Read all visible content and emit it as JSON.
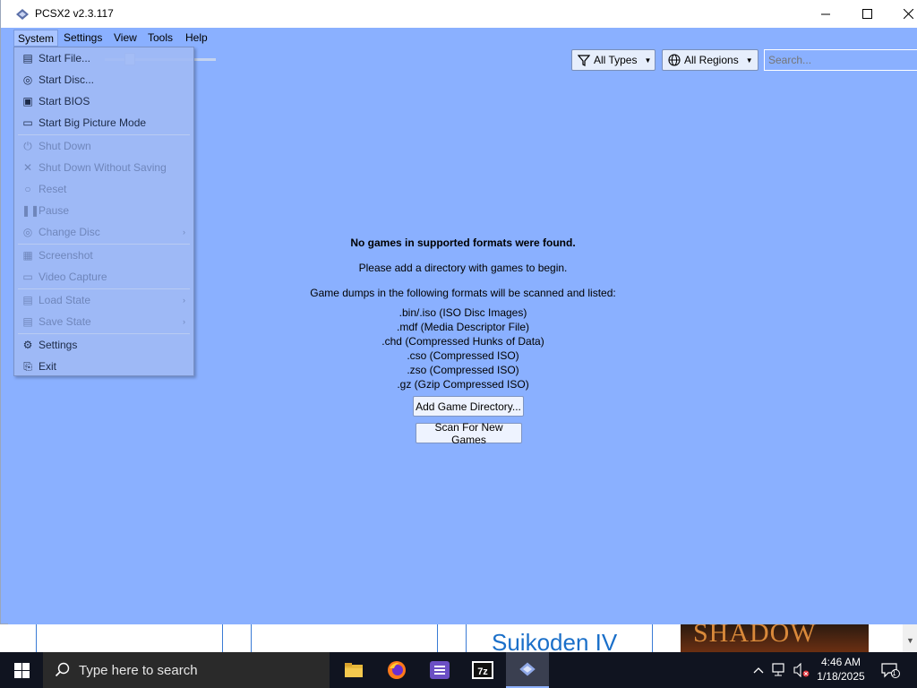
{
  "window": {
    "title": "PCSX2 v2.3.117"
  },
  "menubar": {
    "items": [
      {
        "label": "System"
      },
      {
        "label": "Settings"
      },
      {
        "label": "View"
      },
      {
        "label": "Tools"
      },
      {
        "label": "Help"
      }
    ]
  },
  "toolbar": {
    "type_filter": "All Types",
    "region_filter": "All Regions",
    "search_placeholder": "Search..."
  },
  "system_menu": {
    "items": [
      {
        "label": "Start File...",
        "icon": "file-icon",
        "enabled": true
      },
      {
        "label": "Start Disc...",
        "icon": "disc-icon",
        "enabled": true
      },
      {
        "label": "Start BIOS",
        "icon": "chip-icon",
        "enabled": true
      },
      {
        "label": "Start Big Picture Mode",
        "icon": "big-picture-icon",
        "enabled": true
      },
      {
        "label": "Shut Down",
        "icon": "power-icon",
        "enabled": false
      },
      {
        "label": "Shut Down Without Saving",
        "icon": "close-icon",
        "enabled": false
      },
      {
        "label": "Reset",
        "icon": "reset-icon",
        "enabled": false
      },
      {
        "label": "Pause",
        "icon": "pause-icon",
        "enabled": false
      },
      {
        "label": "Change Disc",
        "icon": "disc-icon",
        "enabled": false
      },
      {
        "label": "Screenshot",
        "icon": "screenshot-icon",
        "enabled": false
      },
      {
        "label": "Video Capture",
        "icon": "video-icon",
        "enabled": false
      },
      {
        "label": "Load State",
        "icon": "load-icon",
        "enabled": false
      },
      {
        "label": "Save State",
        "icon": "save-icon",
        "enabled": false
      },
      {
        "label": "Settings",
        "icon": "gear-icon",
        "enabled": true
      },
      {
        "label": "Exit",
        "icon": "exit-icon",
        "enabled": true
      }
    ]
  },
  "empty_state": {
    "title": "No games in supported formats were found.",
    "subtitle": "Please add a directory with games to begin.",
    "formats_intro": "Game dumps in the following formats will be scanned and listed:",
    "formats": [
      ".bin/.iso (ISO Disc Images)",
      ".mdf (Media Descriptor File)",
      ".chd (Compressed Hunks of Data)",
      ".cso (Compressed ISO)",
      ".zso (Compressed ISO)",
      ".gz (Gzip Compressed ISO)"
    ],
    "add_button": "Add Game Directory...",
    "scan_button": "Scan For New Games"
  },
  "background": {
    "card_text": "Suikoden IV",
    "cover_text": "SHADOW"
  },
  "taskbar": {
    "search_placeholder": "Type here to search",
    "time": "4:46 AM",
    "date": "1/18/2025",
    "notification_count": "1"
  },
  "colors": {
    "window_bg": "#8ab0ff",
    "taskbar_bg": "#101420"
  }
}
